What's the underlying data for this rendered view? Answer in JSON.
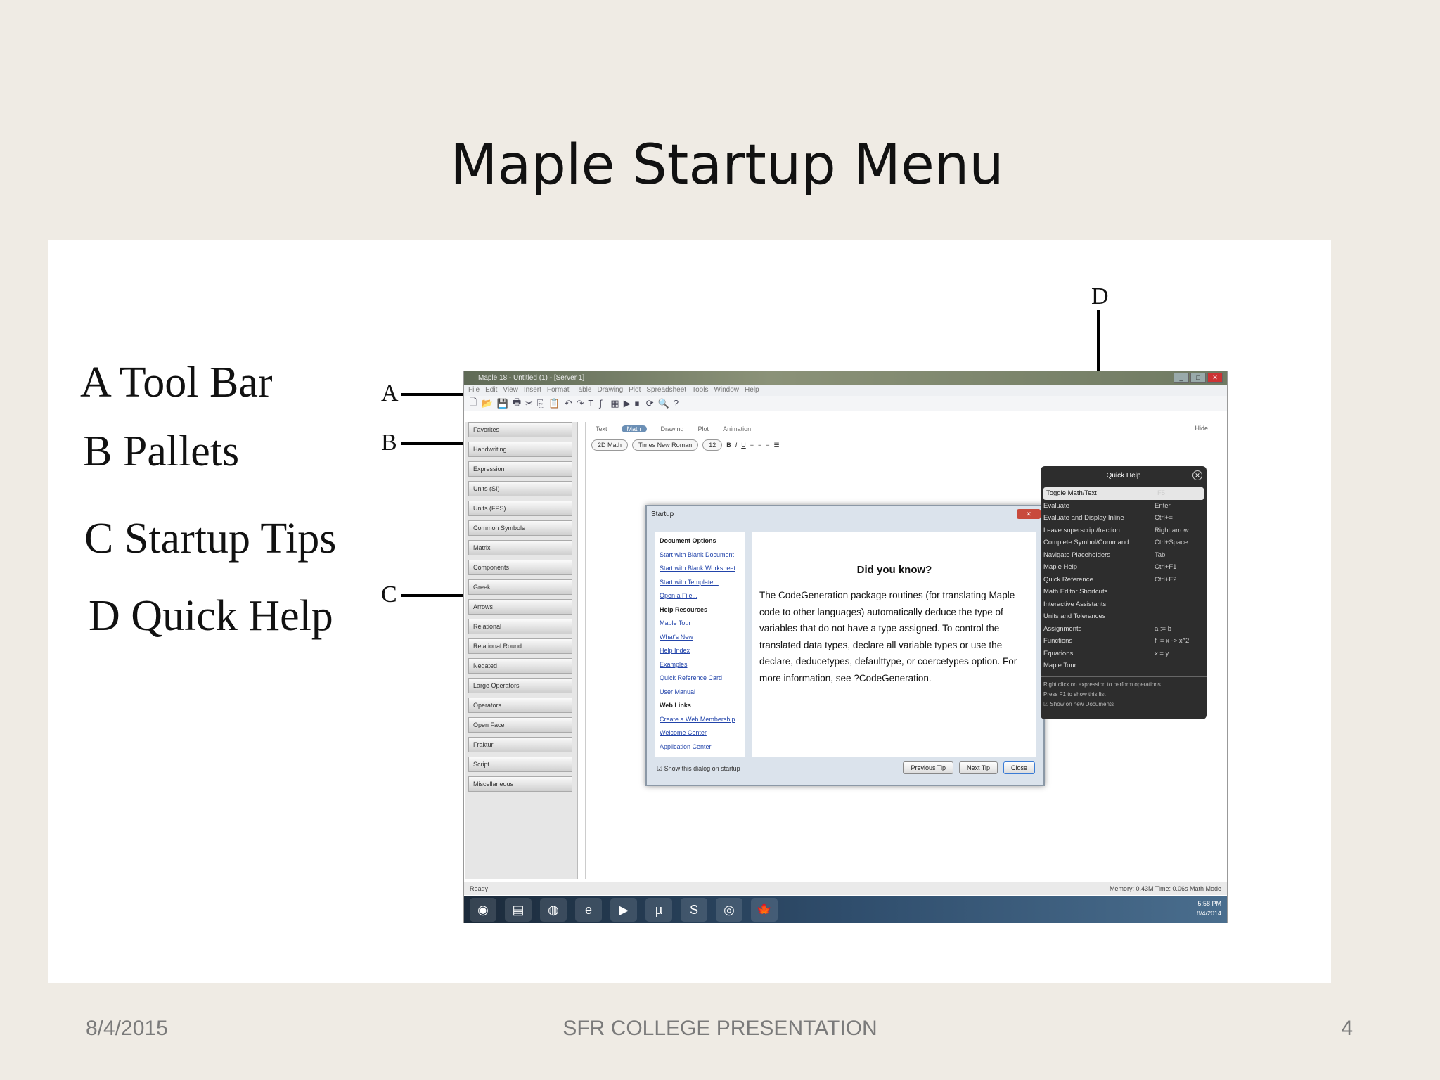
{
  "slide": {
    "title": "Maple Startup Menu",
    "footer_date": "8/4/2015",
    "footer_center": "SFR COLLEGE PRESENTATION",
    "page_number": "4"
  },
  "legend": [
    "A Tool Bar",
    "B Pallets",
    "C Startup Tips",
    "D Quick Help"
  ],
  "callouts": {
    "a": "A",
    "b": "B",
    "c": "C",
    "d": "D"
  },
  "maple": {
    "window_title": "Maple 18 - Untitled (1) - [Server 1]",
    "menu": [
      "File",
      "Edit",
      "View",
      "Insert",
      "Format",
      "Table",
      "Drawing",
      "Plot",
      "Spreadsheet",
      "Tools",
      "Window",
      "Help"
    ],
    "context_tabs": [
      "Text",
      "Math",
      "Drawing",
      "Plot",
      "Animation"
    ],
    "hide_label": "Hide",
    "font_select": "2D Math",
    "face_select": "Times New Roman",
    "size_select": "12",
    "palettes": [
      "Favorites",
      "Handwriting",
      "Expression",
      "Units (SI)",
      "Units (FPS)",
      "Common Symbols",
      "Matrix",
      "Components",
      "Greek",
      "Arrows",
      "Relational",
      "Relational Round",
      "Negated",
      "Large Operators",
      "Operators",
      "Open Face",
      "Fraktur",
      "Script",
      "Miscellaneous"
    ],
    "status_left": "Ready",
    "status_right": "Memory: 0.43M   Time: 0.06s   Math Mode",
    "clock_time": "5:58 PM",
    "clock_date": "8/4/2014"
  },
  "startup": {
    "title": "Startup",
    "sections": [
      {
        "heading": "Document Options",
        "links": [
          "Start with Blank Document",
          "Start with Blank Worksheet",
          "Start with Template...",
          "Open a File..."
        ]
      },
      {
        "heading": "Help Resources",
        "links": [
          "Maple Tour",
          "What's New",
          "Help Index",
          "Examples",
          "Quick Reference Card",
          "User Manual"
        ]
      },
      {
        "heading": "Web Links",
        "links": [
          "Create a Web Membership",
          "Welcome Center",
          "Application Center"
        ]
      }
    ],
    "did_you_know": "Did you know?",
    "tip": "The CodeGeneration package routines (for translating Maple code to other languages) automatically deduce the type of variables that do not have a type assigned. To control the translated data types, declare all variable types or use the declare, deducetypes, defaulttype, or coercetypes option. For more information, see ?CodeGeneration.",
    "show_checkbox": "Show this dialog on startup",
    "buttons": {
      "prev": "Previous Tip",
      "next": "Next Tip",
      "close": "Close"
    }
  },
  "quick_help": {
    "title": "Quick Help",
    "rows": [
      {
        "cmd": "Toggle Math/Text",
        "key": "F5"
      },
      {
        "cmd": "Evaluate",
        "key": "Enter"
      },
      {
        "cmd": "Evaluate and Display Inline",
        "key": "Ctrl+="
      },
      {
        "cmd": "Leave superscript/fraction",
        "key": "Right arrow"
      },
      {
        "cmd": "Complete Symbol/Command",
        "key": "Ctrl+Space"
      },
      {
        "cmd": "Navigate Placeholders",
        "key": "Tab"
      },
      {
        "cmd": "Maple Help",
        "key": "Ctrl+F1"
      },
      {
        "cmd": "Quick Reference",
        "key": "Ctrl+F2"
      },
      {
        "cmd": "Math Editor Shortcuts",
        "key": ""
      },
      {
        "cmd": "Interactive Assistants",
        "key": ""
      },
      {
        "cmd": "Units and Tolerances",
        "key": ""
      },
      {
        "cmd": "Assignments",
        "key": "a := b"
      },
      {
        "cmd": "Functions",
        "key": "f := x -> x^2"
      },
      {
        "cmd": "Equations",
        "key": "x = y"
      },
      {
        "cmd": "Maple Tour",
        "key": ""
      }
    ],
    "foot1": "Right click on expression to perform operations",
    "foot2": "Press F1 to show this list",
    "foot3": "Show on new Documents"
  }
}
